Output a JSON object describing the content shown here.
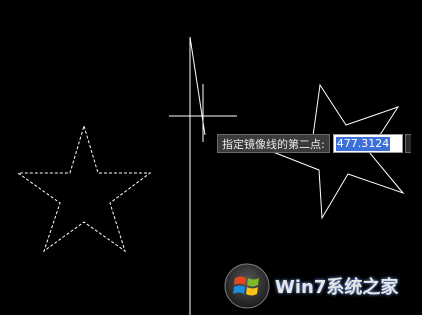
{
  "dynamic_input": {
    "prompt": "指定镜像线的第二点:",
    "value": "477.3124"
  },
  "watermark": {
    "text": "Win7系统之家"
  },
  "colors": {
    "background": "#000000",
    "drawing_lines": "#ffffff",
    "selection_highlight": "#3d6fd8"
  }
}
